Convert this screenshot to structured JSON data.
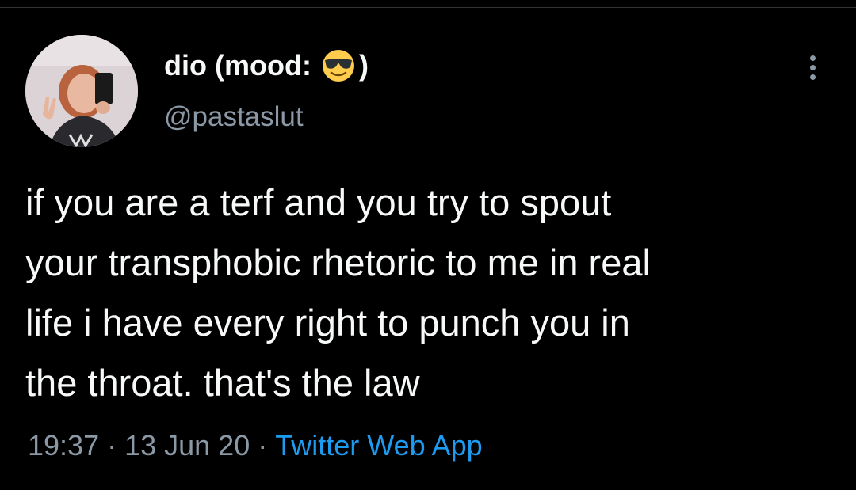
{
  "tweet": {
    "display_name_prefix": "dio (mood:",
    "display_name_suffix": ")",
    "emoji_icon": "smiling-face-with-sunglasses",
    "handle": "@pastaslut",
    "text_lines": [
      "if you are a terf and you try to spout",
      "your transphobic rhetoric to me in real",
      "life i have every right to punch you in",
      "the throat. that's the law"
    ],
    "time": "19:37",
    "separator": "·",
    "date": "13 Jun 20",
    "source": "Twitter Web App"
  },
  "colors": {
    "background": "#000000",
    "text": "#f7f9f9",
    "secondary": "#8b98a5",
    "link": "#1d9bf0"
  }
}
